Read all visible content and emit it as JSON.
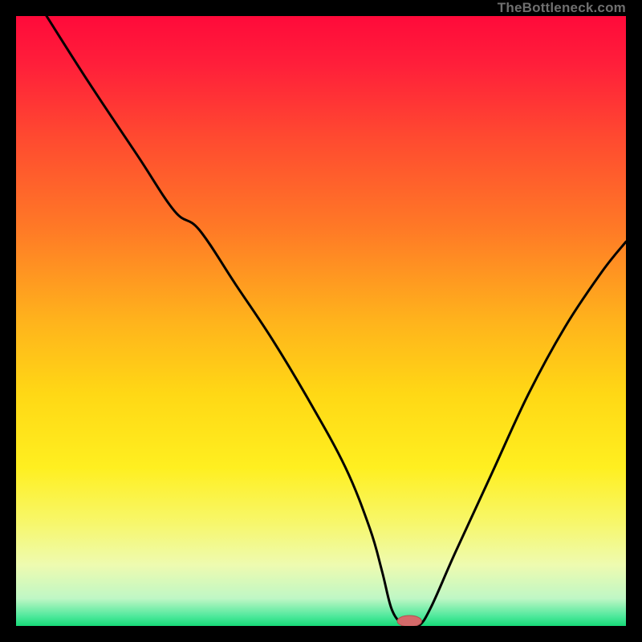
{
  "watermark": "TheBottleneck.com",
  "colors": {
    "frame": "#000000",
    "curve": "#000000",
    "marker_fill": "#d46a6a",
    "marker_stroke": "#b24f4f",
    "gradient_stops": [
      {
        "offset": 0.0,
        "color": "#ff0a3a"
      },
      {
        "offset": 0.08,
        "color": "#ff1f3a"
      },
      {
        "offset": 0.2,
        "color": "#ff4a30"
      },
      {
        "offset": 0.35,
        "color": "#ff7a26"
      },
      {
        "offset": 0.5,
        "color": "#ffb31c"
      },
      {
        "offset": 0.62,
        "color": "#ffd815"
      },
      {
        "offset": 0.74,
        "color": "#ffef20"
      },
      {
        "offset": 0.83,
        "color": "#f7f76a"
      },
      {
        "offset": 0.9,
        "color": "#eefbb0"
      },
      {
        "offset": 0.955,
        "color": "#bff7c5"
      },
      {
        "offset": 0.985,
        "color": "#4be89a"
      },
      {
        "offset": 1.0,
        "color": "#17d977"
      }
    ]
  },
  "chart_data": {
    "type": "line",
    "title": "",
    "xlabel": "",
    "ylabel": "",
    "xlim": [
      0,
      100
    ],
    "ylim": [
      0,
      100
    ],
    "grid": false,
    "series": [
      {
        "name": "bottleneck-curve",
        "x": [
          5,
          12,
          20,
          26,
          30,
          36,
          42,
          48,
          54,
          58,
          60,
          61.5,
          63,
          64,
          66,
          68,
          72,
          78,
          84,
          90,
          96,
          100
        ],
        "values": [
          100,
          89,
          77,
          68,
          65,
          56,
          47,
          37,
          26,
          16,
          9,
          3,
          0.5,
          0,
          0,
          3,
          12,
          25,
          38,
          49,
          58,
          63
        ]
      }
    ],
    "marker": {
      "x": 64.5,
      "y": 0,
      "rx": 2.0,
      "ry": 0.8
    },
    "bottleneck_percent": 0
  }
}
